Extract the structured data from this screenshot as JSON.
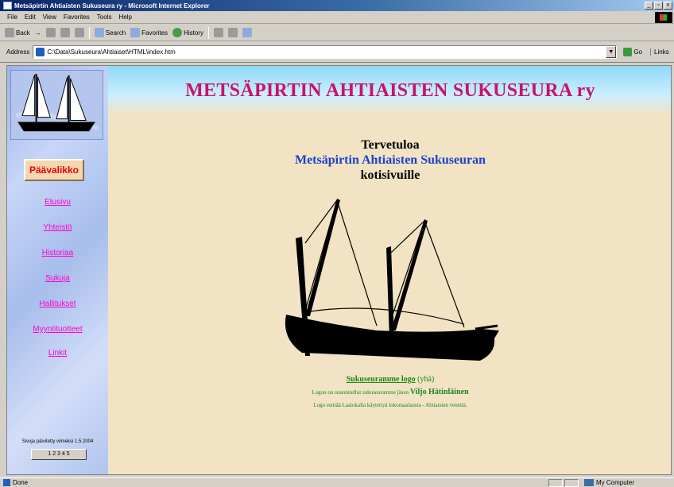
{
  "window": {
    "title": "Metsäpirtin Ahtiaisten Sukuseura ry - Microsoft Internet Explorer",
    "controls": [
      "_",
      "▫",
      "x"
    ]
  },
  "menubar": [
    "File",
    "Edit",
    "View",
    "Favorites",
    "Tools",
    "Help"
  ],
  "toolbar": {
    "back": "Back",
    "forward": "→",
    "stop": "",
    "refresh": "",
    "home": "",
    "search": "Search",
    "favorites": "Favorites",
    "history": "History"
  },
  "address": {
    "label": "Address",
    "value": "C:\\Data\\Sukuseura\\Ahtiaiset\\HTML\\index.htm",
    "go": "Go",
    "links": "Links"
  },
  "page": {
    "banner_title": "METSÄPIRTIN AHTIAISTEN SUKUSEURA ry",
    "main_menu_button": "Päävalikko",
    "side_links": [
      "Etusivu",
      "Yhteistö",
      "Historiaa",
      "Sukuja",
      "Hallitukset",
      "Myyntituotteet",
      "Linkit"
    ],
    "updated": "Sivuja päivitetty viimeksi 1.5.2004",
    "counter": "1 2 3 4 5",
    "welcome_line1": "Tervetuloa",
    "welcome_line2": "Metsäpirtin Ahtiaisten Sukuseuran",
    "welcome_line3": "kotisivuille",
    "footer_link": "Sukuseuramme logo",
    "footer_link_suffix": "(yhä)",
    "footer_line2_prefix": "Logon on suunnitellut sukuseuramme jäsen",
    "footer_line2_name": "Viljo Hätinläinen",
    "footer_line3": "Logo esittää Laatokalla käytettyä lokomaalausta - Ahtiaisten veneitä."
  },
  "statusbar": {
    "text": "Done",
    "zone": "My Computer"
  },
  "colors": {
    "banner_title": "#cc1166",
    "side_link": "#ff00cc",
    "main_menu_text": "#ee0000",
    "welcome_blue": "#1b3fd0",
    "footer_green": "#1a8a1a",
    "page_bg": "#f1e3c3"
  }
}
